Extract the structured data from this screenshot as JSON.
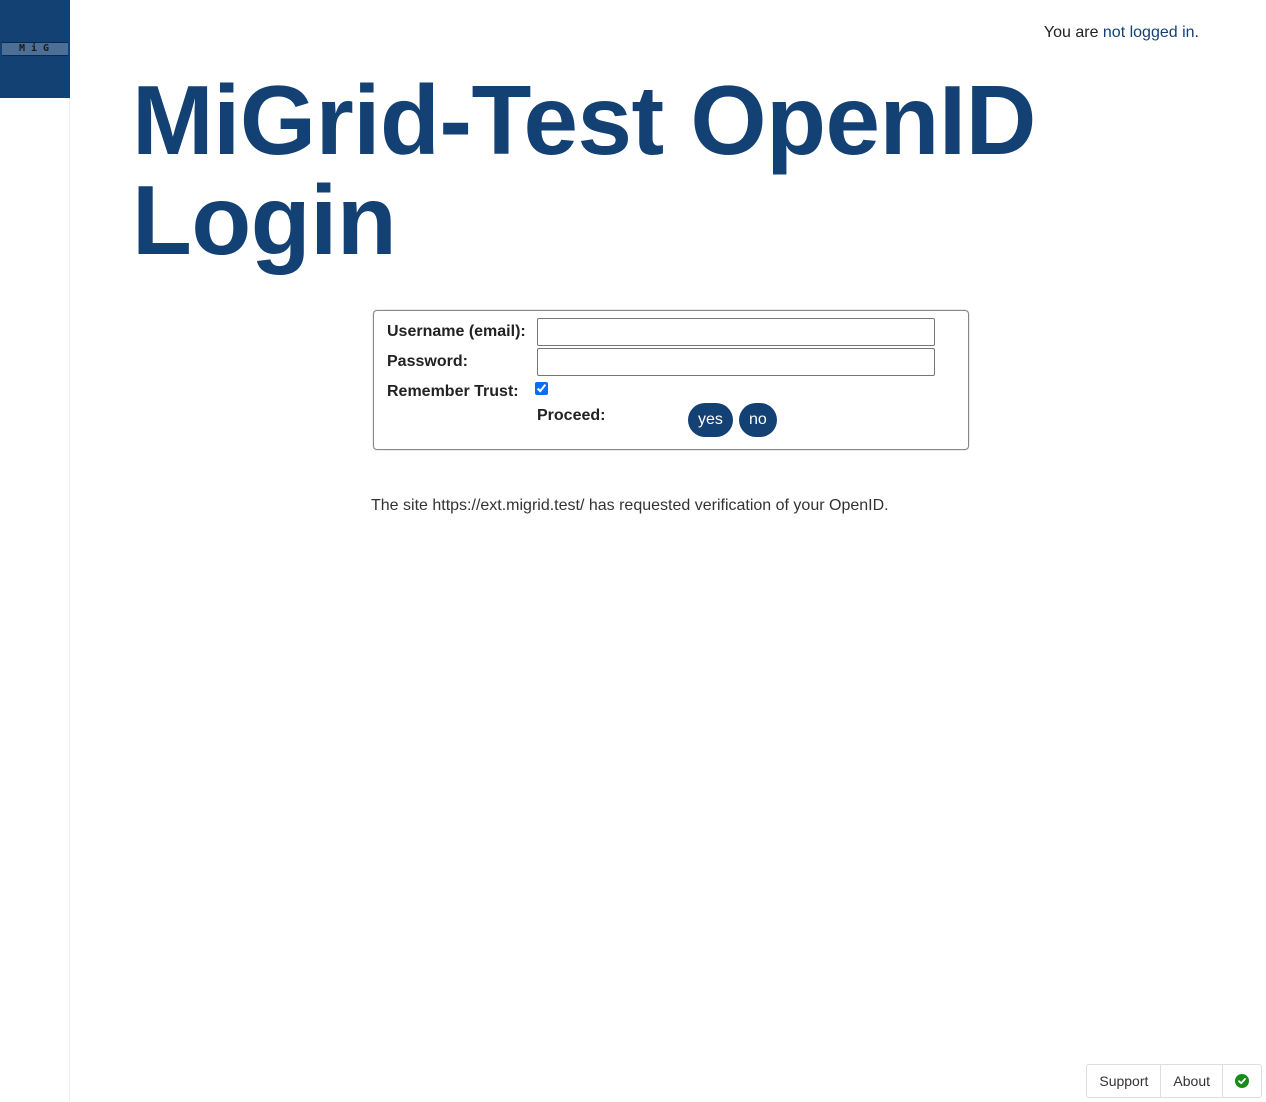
{
  "logo": {
    "text": "MiG"
  },
  "login_status": {
    "prefix": "You are ",
    "link": "not logged in",
    "suffix": "."
  },
  "page": {
    "title": "MiGrid-Test OpenID Login"
  },
  "form": {
    "username_label": "Username (email):",
    "username_value": "",
    "password_label": "Password:",
    "password_value": "",
    "remember_label": "Remember Trust:",
    "remember_checked": true,
    "proceed_label": "Proceed:",
    "yes_label": "yes",
    "no_label": "no"
  },
  "info": {
    "text": "The site https://ext.migrid.test/ has requested verification of your OpenID."
  },
  "footer": {
    "support": "Support",
    "about": "About",
    "status_icon": "check-circle-icon"
  },
  "colors": {
    "brand": "#134174",
    "status_ok": "#1a8a1a"
  }
}
